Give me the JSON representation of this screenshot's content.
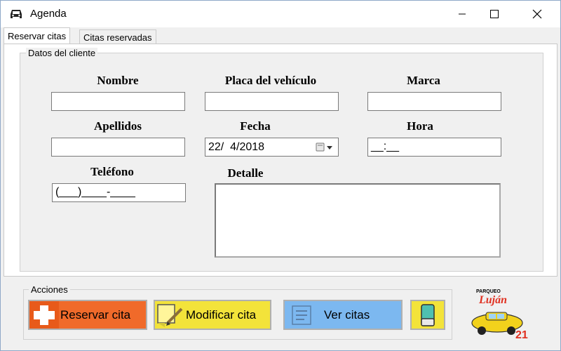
{
  "window": {
    "title": "Agenda",
    "app_icon": "car-icon"
  },
  "tabs": [
    {
      "label": "Reservar citas",
      "active": true
    },
    {
      "label": "Citas reservadas",
      "active": false
    }
  ],
  "client_group": {
    "title": "Datos del cliente",
    "fields": {
      "nombre": {
        "label": "Nombre",
        "value": ""
      },
      "placa": {
        "label": "Placa del vehículo",
        "value": ""
      },
      "marca": {
        "label": "Marca",
        "value": ""
      },
      "apellidos": {
        "label": "Apellidos",
        "value": ""
      },
      "fecha": {
        "label": "Fecha",
        "value": "22/  4/2018"
      },
      "hora": {
        "label": "Hora",
        "value": "__:__"
      },
      "telefono": {
        "label": "Teléfono",
        "value": "(___)____-____"
      },
      "detalle": {
        "label": "Detalle",
        "value": ""
      }
    }
  },
  "actions_group": {
    "title": "Acciones",
    "buttons": {
      "reservar": {
        "label": "Reservar cita",
        "color": "#f06a2a",
        "icon": "plus-icon"
      },
      "modificar": {
        "label": "Modificar cita",
        "color": "#f3e33a",
        "icon": "edit-note-icon"
      },
      "ver": {
        "label": "Ver citas",
        "color": "#7cb8f0",
        "icon": "list-icon"
      },
      "limpiar": {
        "label": "",
        "color": "#f3e33a",
        "icon": "eraser-icon"
      }
    }
  },
  "logo": {
    "top_text": "PARQUEO",
    "brand": "Luján",
    "number": "21"
  }
}
